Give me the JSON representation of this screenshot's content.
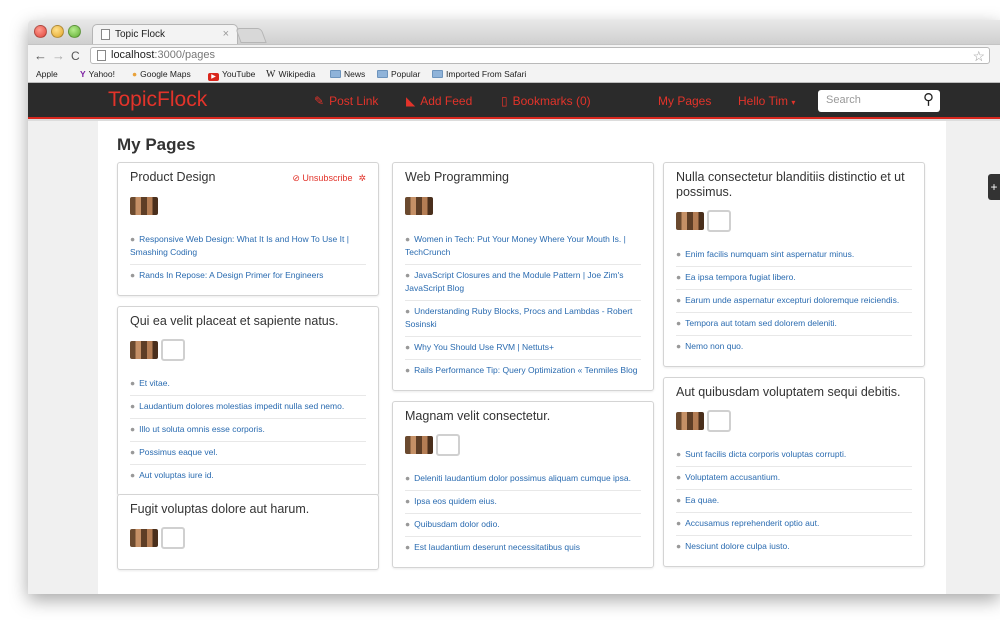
{
  "browser": {
    "tab_title": "Topic Flock",
    "tab_close": "×",
    "url_host": "localhost",
    "url_path": ":3000/pages",
    "bookmarks": [
      {
        "label": "Apple",
        "icon": "apple-icon"
      },
      {
        "label": "Yahoo!",
        "icon": "yahoo-icon"
      },
      {
        "label": "Google Maps",
        "icon": "google-maps-icon"
      },
      {
        "label": "YouTube",
        "icon": "youtube-icon"
      },
      {
        "label": "Wikipedia",
        "icon": "wikipedia-icon"
      },
      {
        "label": "News",
        "icon": "folder-icon"
      },
      {
        "label": "Popular",
        "icon": "folder-icon"
      },
      {
        "label": "Imported From Safari",
        "icon": "folder-icon"
      }
    ]
  },
  "nav": {
    "brand": "TopicFlock",
    "post_link": "Post Link",
    "add_feed": "Add Feed",
    "bookmarks": "Bookmarks (0)",
    "my_pages": "My Pages",
    "user": "Hello Tim",
    "user_caret": "▾",
    "search_placeholder": "Search",
    "accent_color": "#e2332a"
  },
  "page": {
    "title": "My Pages",
    "side_tab": "+"
  },
  "cards": {
    "product_design": {
      "title": "Product Design",
      "unsubscribe": "Unsubscribe",
      "items": [
        "Responsive Web Design: What It Is and How To Use It | Smashing Coding",
        "Rands In Repose: A Design Primer for Engineers"
      ]
    },
    "qui_ea": {
      "title": "Qui ea velit placeat et sapiente natus.",
      "items": [
        "Et vitae.",
        "Laudantium dolores molestias impedit nulla sed nemo.",
        "Illo ut soluta omnis esse corporis.",
        "Possimus eaque vel.",
        "Aut voluptas iure id."
      ]
    },
    "fugit": {
      "title": "Fugit voluptas dolore aut harum."
    },
    "web_programming": {
      "title": "Web Programming",
      "items": [
        "Women in Tech: Put Your Money Where Your Mouth Is. | TechCrunch",
        "JavaScript Closures and the Module Pattern | Joe Zim's JavaScript Blog",
        "Understanding Ruby Blocks, Procs and Lambdas - Robert Sosinski",
        "Why You Should Use RVM | Nettuts+",
        "Rails Performance Tip: Query Optimization « Tenmiles Blog"
      ]
    },
    "magnam": {
      "title": "Magnam velit consectetur.",
      "items": [
        "Deleniti laudantium dolor possimus aliquam cumque ipsa.",
        "Ipsa eos quidem eius.",
        "Quibusdam dolor odio.",
        "Est laudantium deserunt necessitatibus quis"
      ]
    },
    "nulla": {
      "title": "Nulla consectetur blanditiis distinctio et ut possimus.",
      "items": [
        "Enim facilis numquam sint aspernatur minus.",
        "Ea ipsa tempora fugiat libero.",
        "Earum unde aspernatur excepturi doloremque reiciendis.",
        "Tempora aut totam sed dolorem deleniti.",
        "Nemo non quo."
      ]
    },
    "aut": {
      "title": "Aut quibusdam voluptatem sequi debitis.",
      "items": [
        "Sunt facilis dicta corporis voluptas corrupti.",
        "Voluptatem accusantium.",
        "Ea quae.",
        "Accusamus reprehenderit optio aut.",
        "Nesciunt dolore culpa iusto."
      ]
    }
  }
}
